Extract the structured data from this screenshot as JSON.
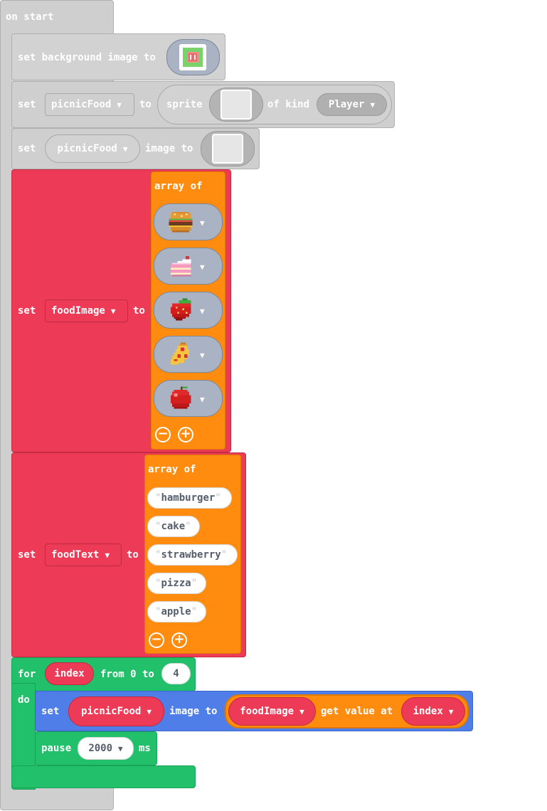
{
  "on_start": {
    "label": "on start"
  },
  "set_background": {
    "set_label": "set background image to"
  },
  "set_sprite": {
    "set_label": "set",
    "variable": "picnicFood",
    "to_label": "to",
    "sprite_label": "sprite",
    "of_kind_label": "of kind",
    "kind": "Player"
  },
  "set_sprite_image": {
    "set_label": "set",
    "variable": "picnicFood",
    "image_to_label": "image to"
  },
  "set_food_image": {
    "set_label": "set",
    "variable": "foodImage",
    "to_label": "to",
    "array_label": "array of",
    "items": [
      {
        "icon": "hamburger-icon"
      },
      {
        "icon": "cake-icon"
      },
      {
        "icon": "strawberry-icon"
      },
      {
        "icon": "pizza-icon"
      },
      {
        "icon": "apple-icon"
      }
    ]
  },
  "set_food_text": {
    "set_label": "set",
    "variable": "foodText",
    "to_label": "to",
    "array_label": "array of",
    "items": [
      "hamburger",
      "cake",
      "strawberry",
      "pizza",
      "apple"
    ]
  },
  "for_loop": {
    "for_label": "for",
    "index_var": "index",
    "from_label": "from 0 to",
    "to_value": "4",
    "do_label": "do"
  },
  "set_image_in_loop": {
    "set_label": "set",
    "variable": "picnicFood",
    "image_to_label": "image to",
    "array_var": "foodImage",
    "get_value_label": "get value at",
    "index_var": "index"
  },
  "pause": {
    "pause_label": "pause",
    "value": "2000",
    "unit": "ms"
  },
  "colors": {
    "events": "#cfcfcf",
    "variables": "#ed3a56",
    "arrays": "#ff8c0f",
    "loops": "#22c06a",
    "sprites": "#4f7ee8"
  }
}
